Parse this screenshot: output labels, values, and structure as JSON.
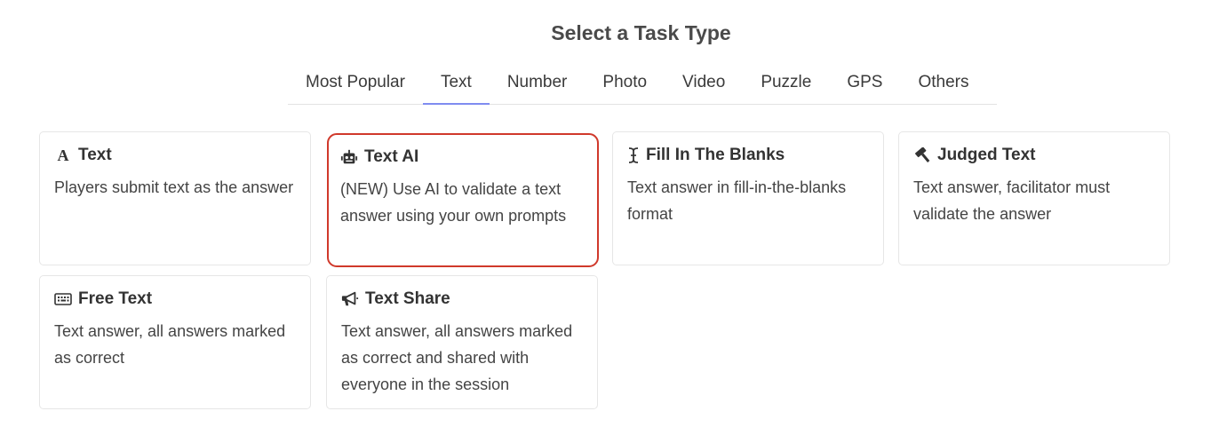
{
  "header": {
    "title": "Select a Task Type"
  },
  "tabs": [
    {
      "label": "Most Popular",
      "active": false
    },
    {
      "label": "Text",
      "active": true
    },
    {
      "label": "Number",
      "active": false
    },
    {
      "label": "Photo",
      "active": false
    },
    {
      "label": "Video",
      "active": false
    },
    {
      "label": "Puzzle",
      "active": false
    },
    {
      "label": "GPS",
      "active": false
    },
    {
      "label": "Others",
      "active": false
    }
  ],
  "cards": [
    {
      "icon": "font-a-icon",
      "title": "Text",
      "description": "Players submit text as the answer",
      "selected": false
    },
    {
      "icon": "robot-icon",
      "title": "Text AI",
      "description": "(NEW) Use AI to validate a text answer using your own prompts",
      "selected": true
    },
    {
      "icon": "text-cursor-icon",
      "title": "Fill In The Blanks",
      "description": "Text answer in fill-in-the-blanks format",
      "selected": false
    },
    {
      "icon": "gavel-icon",
      "title": "Judged Text",
      "description": "Text answer, facilitator must validate the answer",
      "selected": false
    },
    {
      "icon": "keyboard-icon",
      "title": "Free Text",
      "description": "Text answer, all answers marked as correct",
      "selected": false
    },
    {
      "icon": "megaphone-icon",
      "title": "Text Share",
      "description": "Text answer, all answers marked as correct and shared with everyone in the session",
      "selected": false
    }
  ],
  "colors": {
    "selected_border": "#d0392b",
    "active_tab_underline": "#7f8cf0",
    "card_border": "#e6e6e6"
  }
}
